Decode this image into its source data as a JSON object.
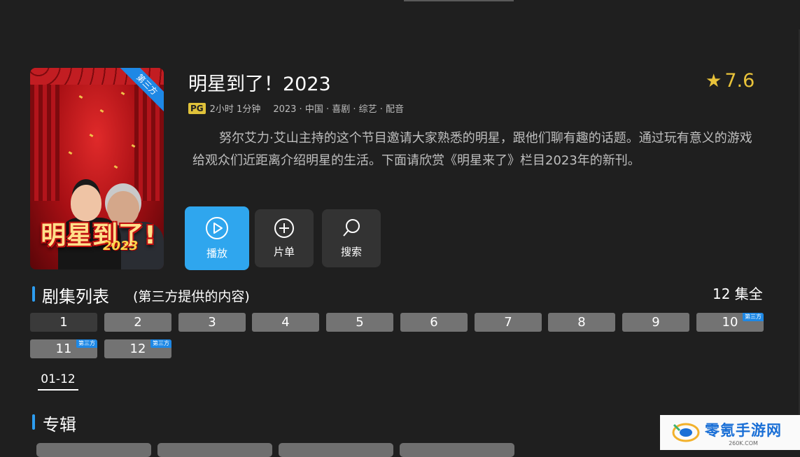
{
  "app": {
    "accent": "#2fa6ee",
    "background": "#1f1f1f"
  },
  "poster": {
    "title_art": "明星到了!",
    "year_art": "2023",
    "badge": "第三方"
  },
  "detail": {
    "title": "明星到了！2023",
    "rating": "7.6",
    "rating_icon": "star-icon",
    "pg": "PG",
    "duration": "2小时 1分钟",
    "info": "2023 · 中国 · 喜剧 · 综艺 · 配音",
    "description": "努尔艾力·艾山主持的这个节目邀请大家熟悉的明星，跟他们聊有趣的话题。通过玩有意义的游戏给观众们近距离介绍明星的生活。下面请欣赏《明星来了》栏目2023年的新刊。"
  },
  "actions": [
    {
      "label": "播放",
      "icon": "play-icon"
    },
    {
      "label": "片单",
      "icon": "add-circle-icon"
    },
    {
      "label": "搜索",
      "icon": "search-icon"
    }
  ],
  "episodes": {
    "title": "剧集列表",
    "subtitle": "(第三方提供的内容)",
    "total": "12 集全",
    "tag": "第三方",
    "items": [
      "1",
      "2",
      "3",
      "4",
      "5",
      "6",
      "7",
      "8",
      "9",
      "10",
      "11",
      "12"
    ],
    "active": "1",
    "range_tab": "01-12"
  },
  "album": {
    "title": "专辑"
  },
  "watermark": {
    "main": "零氪手游网",
    "sub": "260K.COM"
  }
}
